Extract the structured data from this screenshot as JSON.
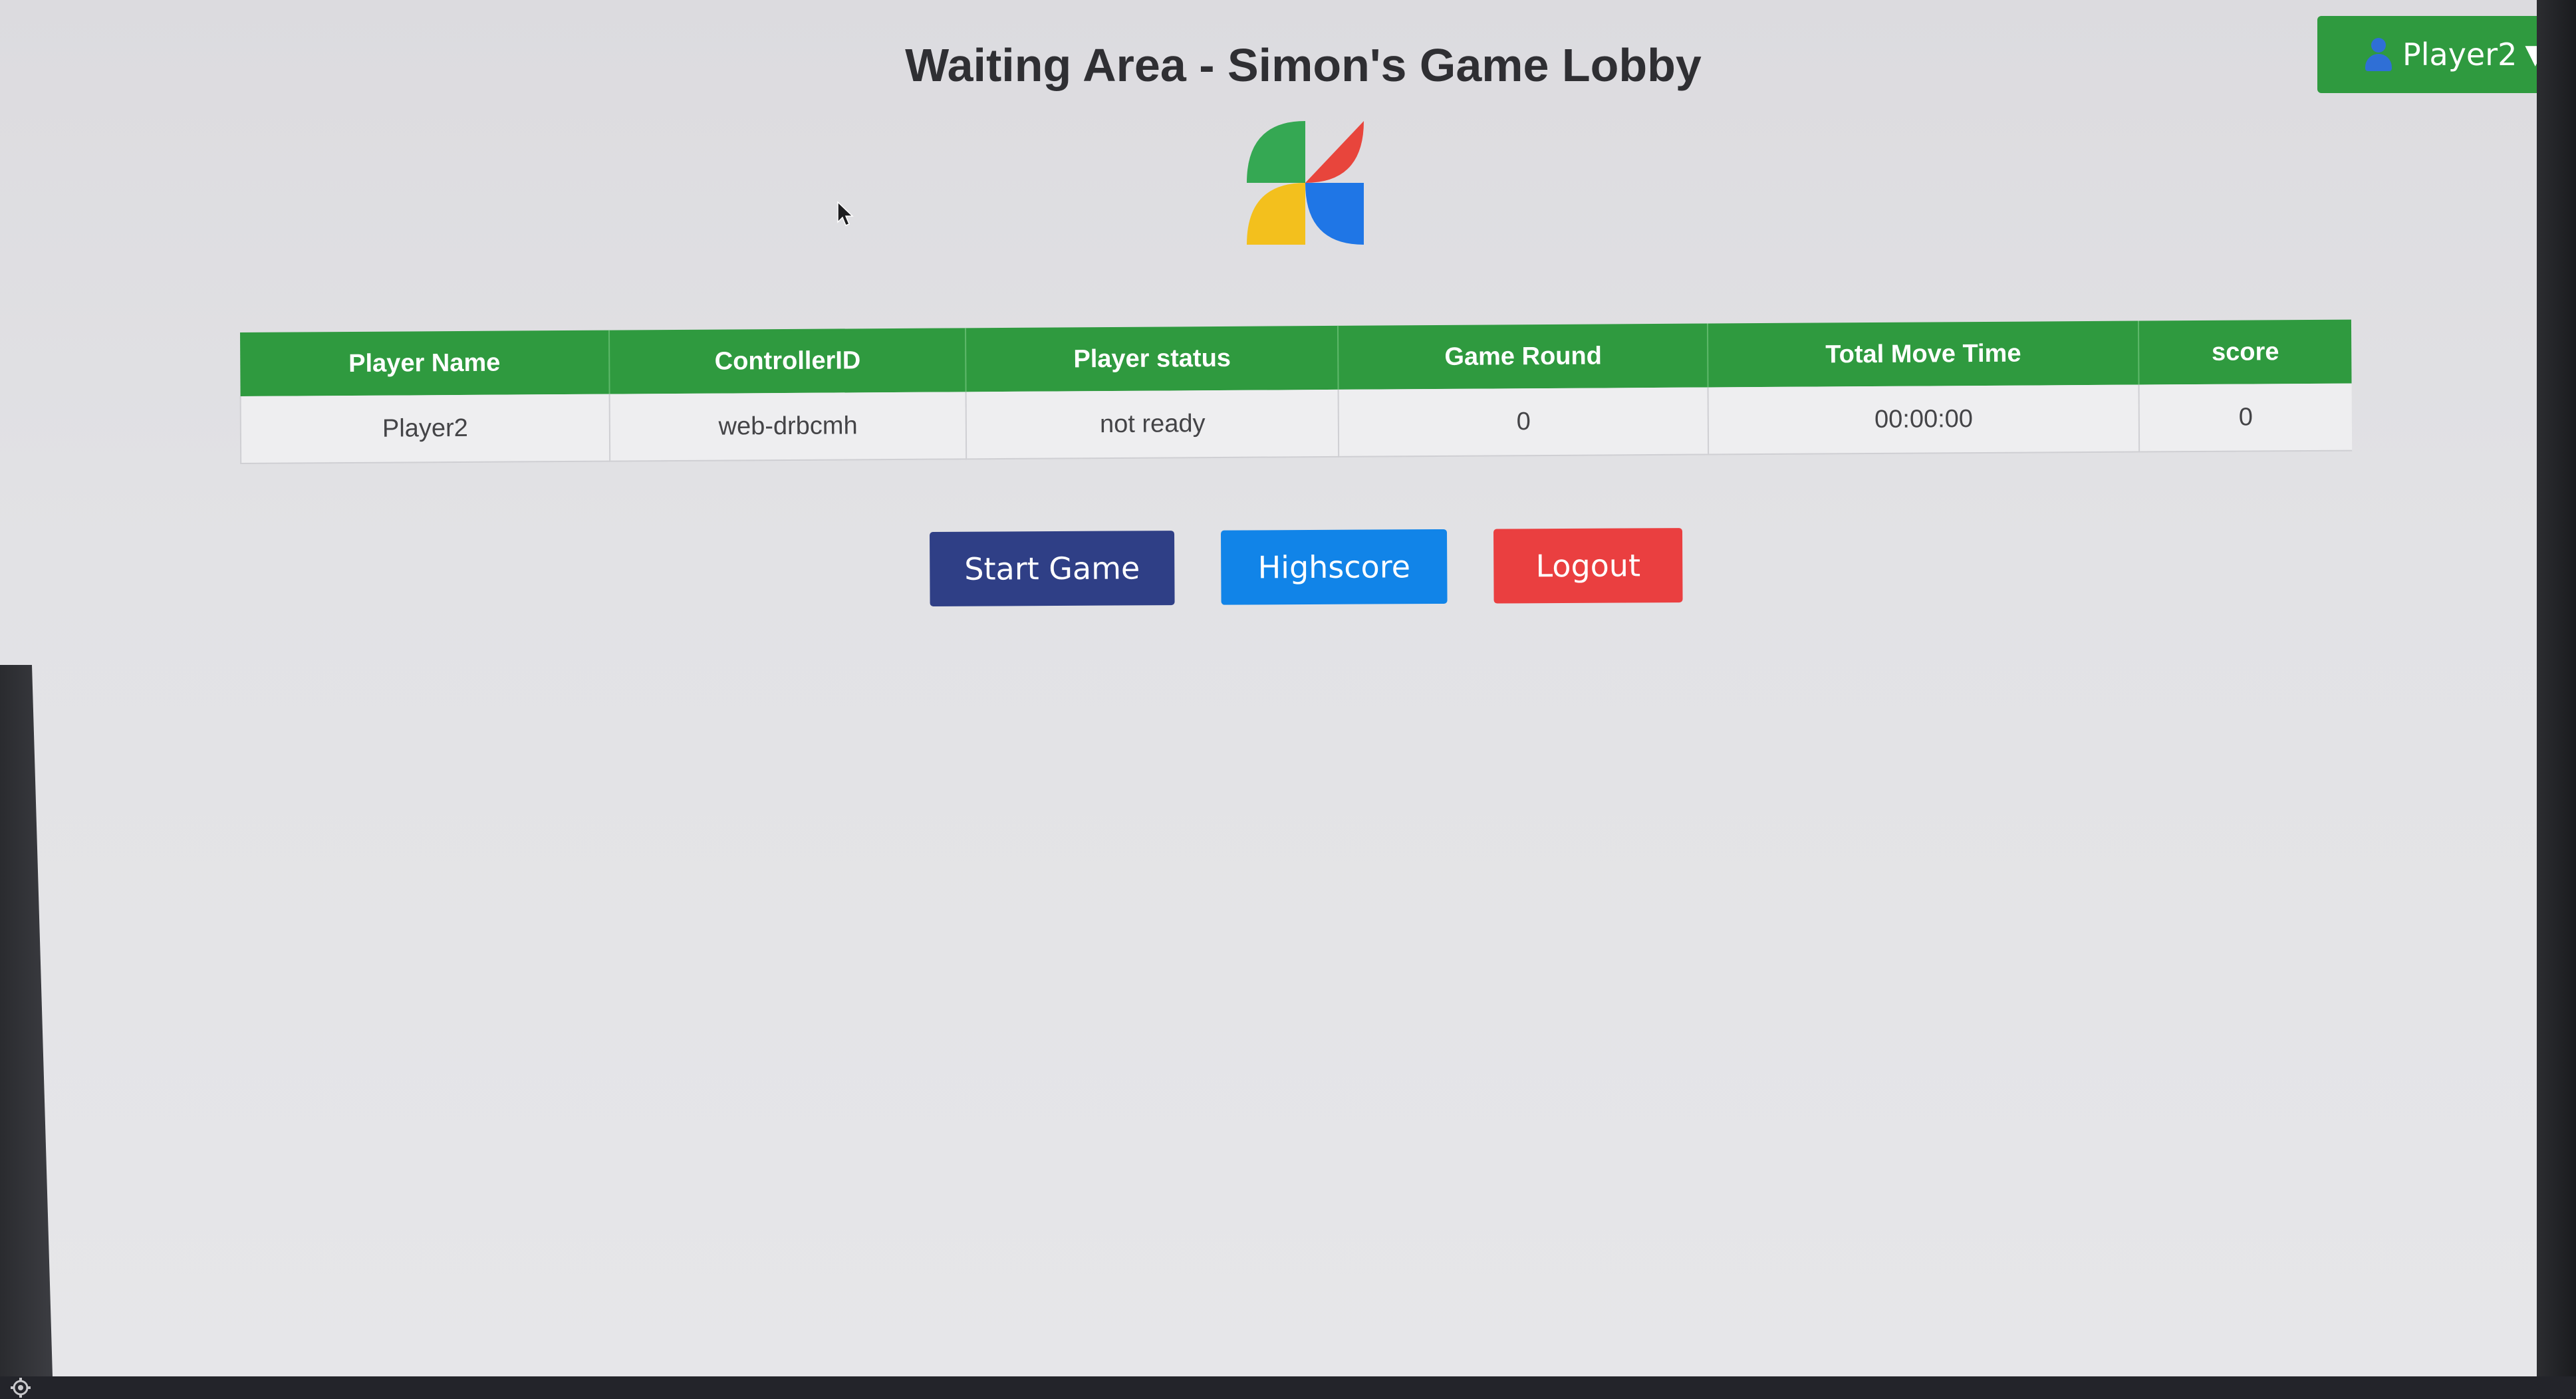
{
  "page": {
    "title": "Waiting Area - Simon's Game Lobby"
  },
  "user_menu": {
    "icon": "user-icon",
    "label": "Player2",
    "caret": "▼"
  },
  "logo": {
    "icon": "pinwheel-logo",
    "colors": [
      "#35a853",
      "#e8453c",
      "#4285f4",
      "#f8bd0b"
    ]
  },
  "table": {
    "headers": [
      "Player Name",
      "ControllerID",
      "Player status",
      "Game Round",
      "Total Move Time",
      "score"
    ],
    "rows": [
      [
        "Player2",
        "web-drbcmh",
        "not ready",
        "0",
        "00:00:00",
        "0"
      ]
    ]
  },
  "buttons": {
    "start_game": "Start Game",
    "highscore": "Highscore",
    "logout": "Logout"
  },
  "colors": {
    "green": "#2f9a3f",
    "start": "#2f3f86",
    "highscore": "#1184e8",
    "logout": "#ea3f40"
  }
}
